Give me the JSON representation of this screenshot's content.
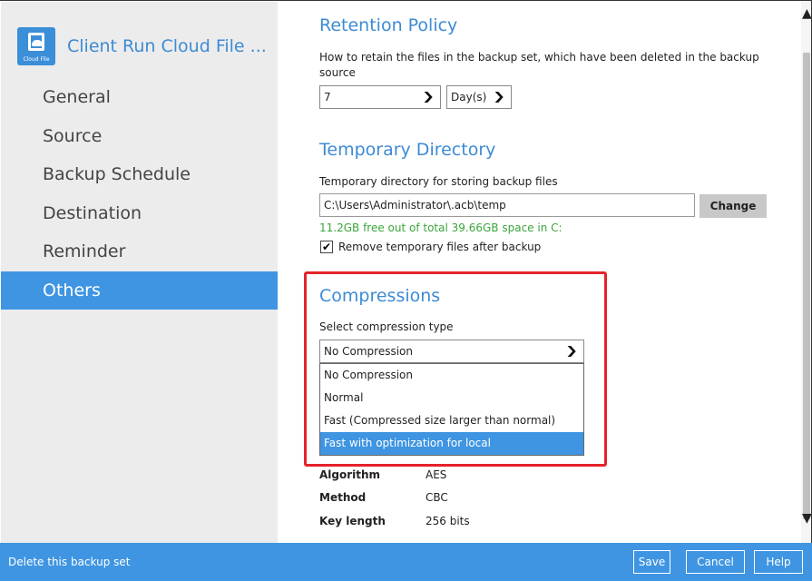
{
  "app": {
    "title": "Client Run Cloud File ...",
    "logo_caption": "Cloud File",
    "logo_icon": "cloud-file-icon"
  },
  "nav": {
    "items": [
      {
        "label": "General"
      },
      {
        "label": "Source"
      },
      {
        "label": "Backup Schedule"
      },
      {
        "label": "Destination"
      },
      {
        "label": "Reminder"
      },
      {
        "label": "Others",
        "active": true
      }
    ]
  },
  "retention": {
    "heading": "Retention Policy",
    "description": "How to retain the files in the backup set, which have been deleted in the backup source",
    "desc_line1": "How to retain the files in the backup set, which have been deleted in the backup",
    "desc_line2": "source",
    "value": "7",
    "unit": "Day(s)"
  },
  "temp_dir": {
    "heading": "Temporary Directory",
    "label": "Temporary directory for storing backup files",
    "path": "C:\\Users\\Administrator\\.acb\\temp",
    "change_label": "Change",
    "free_space": "11.2GB free out of total 39.66GB space in C:",
    "remove_label": "Remove temporary files after backup",
    "remove_checked": true
  },
  "compressions": {
    "heading": "Compressions",
    "label": "Select compression type",
    "selected": "No Compression",
    "options": [
      "No Compression",
      "Normal",
      "Fast (Compressed size larger than normal)",
      "Fast with optimization for local"
    ],
    "highlighted_index": 3
  },
  "encryption": {
    "rows": [
      {
        "key": "Algorithm",
        "value": "AES"
      },
      {
        "key": "Method",
        "value": "CBC"
      },
      {
        "key": "Key length",
        "value": "256 bits"
      }
    ]
  },
  "footer": {
    "delete_label": "Delete this backup set",
    "save_label": "Save",
    "cancel_label": "Cancel",
    "help_label": "Help"
  },
  "colors": {
    "accent": "#3f95e2",
    "heading": "#3d8bd4",
    "highlight_box": "#e5232a",
    "free_space_text": "#3aa53a"
  }
}
